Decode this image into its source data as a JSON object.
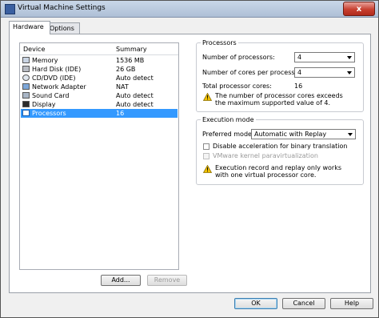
{
  "window": {
    "title": "Virtual Machine Settings",
    "close_label": "x"
  },
  "tabs": [
    {
      "label": "Hardware",
      "active": true
    },
    {
      "label": "Options",
      "active": false
    }
  ],
  "device_list": {
    "columns": {
      "device": "Device",
      "summary": "Summary"
    },
    "rows": [
      {
        "name": "Memory",
        "summary": "1536 MB",
        "icon": "memory-icon"
      },
      {
        "name": "Hard Disk (IDE)",
        "summary": "26 GB",
        "icon": "hard-disk-icon"
      },
      {
        "name": "CD/DVD (IDE)",
        "summary": "Auto detect",
        "icon": "cd-dvd-icon"
      },
      {
        "name": "Network Adapter",
        "summary": "NAT",
        "icon": "network-adapter-icon"
      },
      {
        "name": "Sound Card",
        "summary": "Auto detect",
        "icon": "sound-card-icon"
      },
      {
        "name": "Display",
        "summary": "Auto detect",
        "icon": "display-icon"
      },
      {
        "name": "Processors",
        "summary": "16",
        "icon": "processor-icon",
        "selected": true
      }
    ],
    "add_label": "Add...",
    "remove_label": "Remove"
  },
  "processors": {
    "title": "Processors",
    "num_processors_label": "Number of processors:",
    "num_processors_value": "4",
    "cores_label": "Number of cores per processor:",
    "cores_value": "4",
    "total_label": "Total processor cores:",
    "total_value": "16",
    "warning": "The number of processor cores exceeds the maximum supported value of 4."
  },
  "execution_mode": {
    "title": "Execution mode",
    "preferred_label": "Preferred mode:",
    "preferred_value": "Automatic with Replay",
    "disable_accel_label": "Disable acceleration for binary translation",
    "disable_accel_checked": false,
    "vmware_kernel_label": "VMware kernel paravirtualization",
    "vmware_kernel_enabled": false,
    "warning": "Execution record and replay only works with one virtual processor core."
  },
  "footer": {
    "ok_label": "OK",
    "cancel_label": "Cancel",
    "help_label": "Help"
  },
  "colors": {
    "selection": "#3399ff",
    "window_bg": "#f0f0f0",
    "close_button": "#c84030",
    "warning": "#f2c200"
  }
}
